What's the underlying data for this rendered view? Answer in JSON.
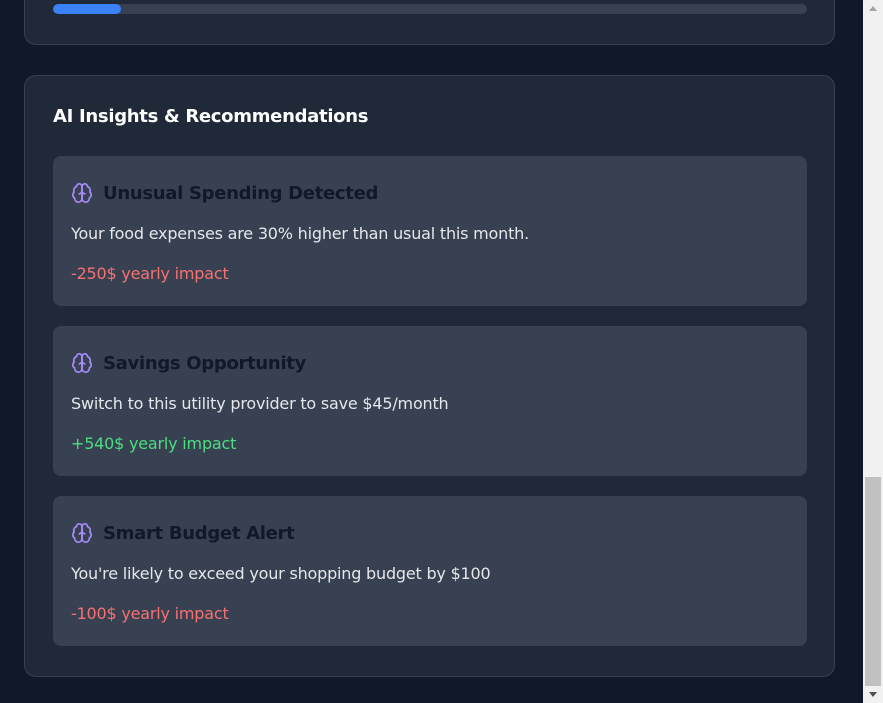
{
  "progress": {
    "value_fraction": 0.09,
    "color": "#3b82f6"
  },
  "insights_section": {
    "title": "AI Insights & Recommendations",
    "items": [
      {
        "icon": "brain-icon",
        "title": "Unusual Spending Detected",
        "description": "Your food expenses are 30% higher than usual this month.",
        "impact": "-250$ yearly impact",
        "impact_type": "negative"
      },
      {
        "icon": "brain-icon",
        "title": "Savings Opportunity",
        "description": "Switch to this utility provider to save $45/month",
        "impact": "+540$ yearly impact",
        "impact_type": "positive"
      },
      {
        "icon": "brain-icon",
        "title": "Smart Budget Alert",
        "description": "You're likely to exceed your shopping budget by $100",
        "impact": "-100$ yearly impact",
        "impact_type": "negative"
      }
    ]
  },
  "colors": {
    "background": "#111827",
    "card": "#1f2937",
    "insight_card": "#374151",
    "icon_purple": "#a78bfa",
    "negative": "#f87171",
    "positive": "#4ade80"
  }
}
